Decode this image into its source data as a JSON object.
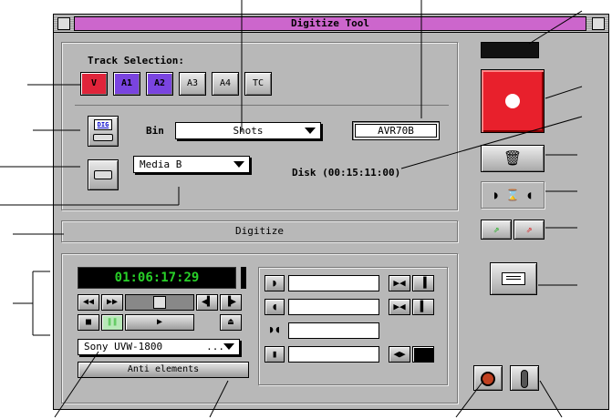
{
  "window": {
    "title": "Digitize Tool"
  },
  "tracks": {
    "label": "Track Selection:",
    "buttons": [
      {
        "label": "V",
        "state": "on",
        "color": "#e0243a"
      },
      {
        "label": "A1",
        "state": "on",
        "color": "#7a44e0"
      },
      {
        "label": "A2",
        "state": "on",
        "color": "#7a44e0"
      },
      {
        "label": "A3",
        "state": "off",
        "color": "#d8d8d8"
      },
      {
        "label": "A4",
        "state": "off",
        "color": "#d8d8d8"
      },
      {
        "label": "TC",
        "state": "off",
        "color": "#d8d8d8"
      }
    ]
  },
  "settings": {
    "dig_label": "DIG",
    "bin_label": "Bin",
    "bin_value": "Shots",
    "tape_name": "AVR70B",
    "media_value": "Media B",
    "disk_text": "Disk (00:15:11:00)"
  },
  "digitize_bar": {
    "label": "Digitize"
  },
  "deck": {
    "timecode": "01:06:17:29",
    "deck_name": "Sony UVW-1800",
    "deck_suffix": "...",
    "anti_label": "Anti elements"
  },
  "colors": {
    "record": "#e8202c",
    "tc_text": "#28d028",
    "title_accent": "#cc66cc"
  }
}
